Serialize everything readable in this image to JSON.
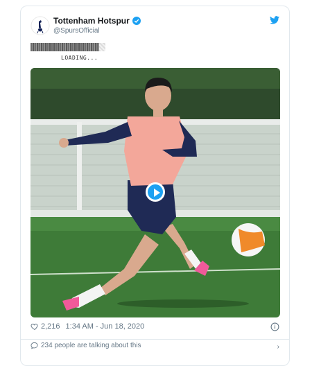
{
  "tweet": {
    "display_name": "Tottenham Hotspur",
    "handle": "@SpursOfficial",
    "loading_text": "LOADING...",
    "likes": "2,216",
    "timestamp": "1:34 AM - Jun 18, 2020",
    "talking": "234 people are talking about this"
  },
  "colors": {
    "accent": "#1da1f2",
    "pitch": "#3d7a3a",
    "shirt": "#f3a79a",
    "sleeve": "#1f2a55"
  },
  "icons": {
    "avatar": "spurs-cockerel-logo",
    "verified": "verified-badge-icon",
    "bird": "twitter-bird-icon",
    "play": "play-icon",
    "heart": "heart-icon",
    "info": "info-icon",
    "bubble": "comment-bubble-icon",
    "chevron": "chevron-right-icon"
  }
}
